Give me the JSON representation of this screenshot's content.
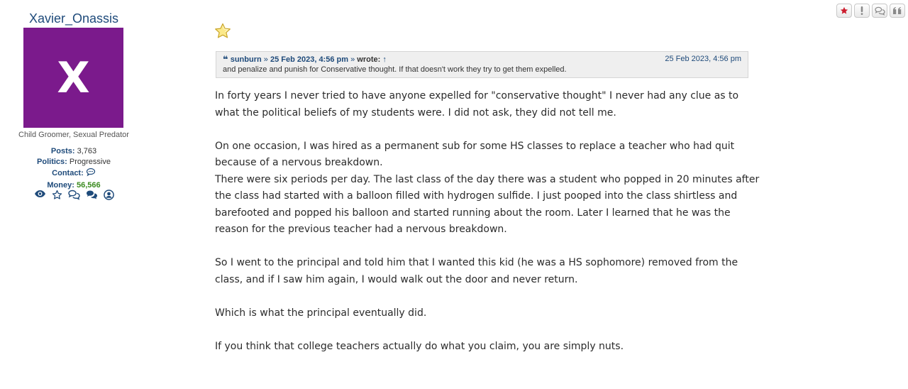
{
  "profile": {
    "username": "Xavier_Onassis",
    "avatar_letter": "X",
    "avatar_color": "#7b1a8c",
    "rank": "Child Groomer, Sexual Predator",
    "posts_label": "Posts:",
    "posts_value": "3,763",
    "politics_label": "Politics:",
    "politics_value": "Progressive",
    "contact_label": "Contact:",
    "money_label": "Money:",
    "money_value": "56,566",
    "icons": [
      "eye-icon",
      "star-outline-icon",
      "chat-bubbles-icon",
      "comments-icon",
      "user-circle-icon"
    ]
  },
  "post_buttons": [
    "report-star-icon",
    "warn-exclamation-icon",
    "pm-chat-icon",
    "quote-icon"
  ],
  "quote": {
    "mark": "❝",
    "author": "sunburn",
    "sep1": "»",
    "date_link": "25 Feb 2023, 4:56 pm",
    "sep2": "»",
    "wrote": "wrote:",
    "arrow": "↑",
    "date_right": "25 Feb 2023, 4:56 pm",
    "text": "and penalize and punish for Conservative thought.  If that doesn't work they try to get them expelled."
  },
  "post": {
    "p1": "In forty years I never tried to have anyone expelled for \"conservative thought\"  I never had any clue as to what the political beliefs of my students were. I did not ask, they did not tell me.",
    "p2": "On one occasion, I was hired as a permanent sub for some HS classes to replace a teacher who had quit because of a nervous breakdown.",
    "p3": "There were six periods per day. The last class of the day there was a student who popped in 20 minutes after the class had started with a balloon filled with hydrogen sulfide.  I just pooped into the class shirtless and barefooted and popped his balloon and started running about the room. Later I learned that he was the reason for the previous teacher had a nervous breakdown.",
    "p4": "So I went to the principal and told him that I wanted this kid  (he was a HS sophomore) removed from the class, and if I saw him again, I would walk out the door and never return.",
    "p5": "Which is what the principal eventually did.",
    "p6": "If you think that college teachers actually do what you claim, you are simply nuts."
  }
}
